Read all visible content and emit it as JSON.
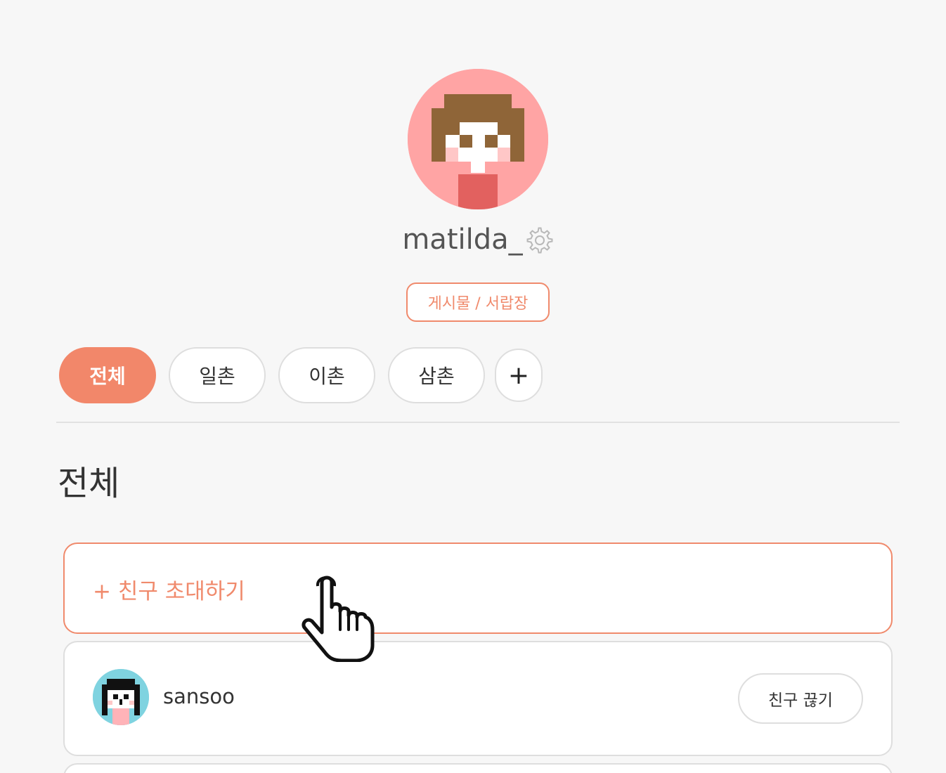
{
  "profile": {
    "username": "matilda_",
    "settings_icon": "gear-icon",
    "posts_button_label": "게시물 / 서랍장"
  },
  "tabs": [
    {
      "label": "전체",
      "active": true
    },
    {
      "label": "일촌",
      "active": false
    },
    {
      "label": "이촌",
      "active": false
    },
    {
      "label": "삼촌",
      "active": false
    }
  ],
  "add_tab_label": "+",
  "section": {
    "title": "전체"
  },
  "invite": {
    "label": "+ 친구 초대하기"
  },
  "friends": [
    {
      "name": "sansoo",
      "action_label": "친구 끊기"
    }
  ],
  "colors": {
    "accent": "#f2876a",
    "background": "#f7f7f7",
    "avatar_bg": "#ffa4a4",
    "friend_avatar_bg": "#7fd3e0"
  }
}
